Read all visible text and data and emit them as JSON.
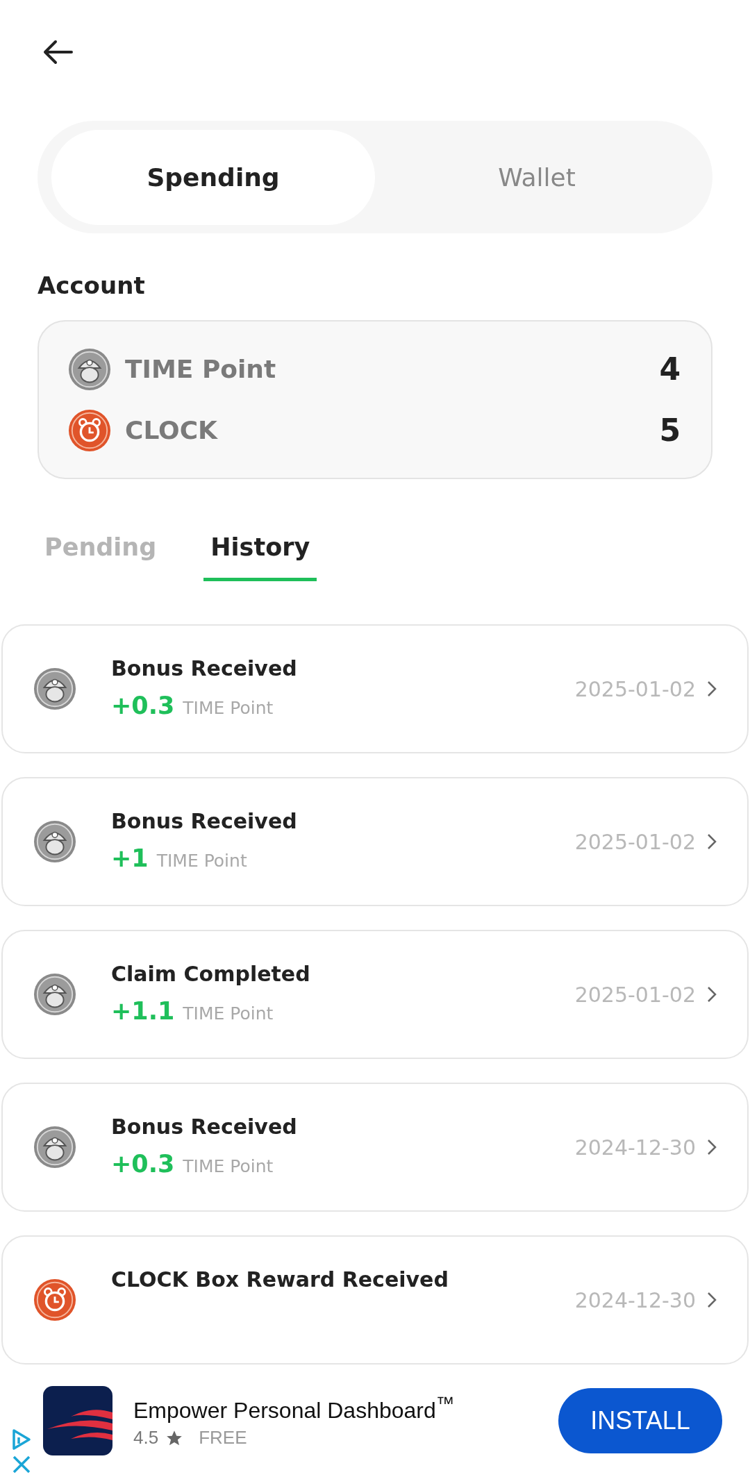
{
  "segments": [
    {
      "label": "Spending",
      "selected": true
    },
    {
      "label": "Wallet",
      "selected": false
    }
  ],
  "account": {
    "title": "Account",
    "balances": [
      {
        "kind": "time",
        "name": "TIME Point",
        "value": "4"
      },
      {
        "kind": "clock",
        "name": "CLOCK",
        "value": "5"
      }
    ]
  },
  "tabs": [
    {
      "label": "Pending",
      "selected": false
    },
    {
      "label": "History",
      "selected": true
    }
  ],
  "history": [
    {
      "kind": "time",
      "title": "Bonus Received",
      "amount": "+0.3",
      "unit": "TIME Point",
      "date": "2025-01-02"
    },
    {
      "kind": "time",
      "title": "Bonus Received",
      "amount": "+1",
      "unit": "TIME Point",
      "date": "2025-01-02"
    },
    {
      "kind": "time",
      "title": "Claim Completed",
      "amount": "+1.1",
      "unit": "TIME Point",
      "date": "2025-01-02"
    },
    {
      "kind": "time",
      "title": "Bonus Received",
      "amount": "+0.3",
      "unit": "TIME Point",
      "date": "2024-12-30"
    },
    {
      "kind": "clock",
      "title": "CLOCK Box Reward Received",
      "date": "2024-12-30"
    }
  ],
  "ad": {
    "app_name": "Empower Personal Dashboard$^{™}$",
    "rating": "4.5",
    "price": "FREE",
    "button": "INSTALL"
  }
}
